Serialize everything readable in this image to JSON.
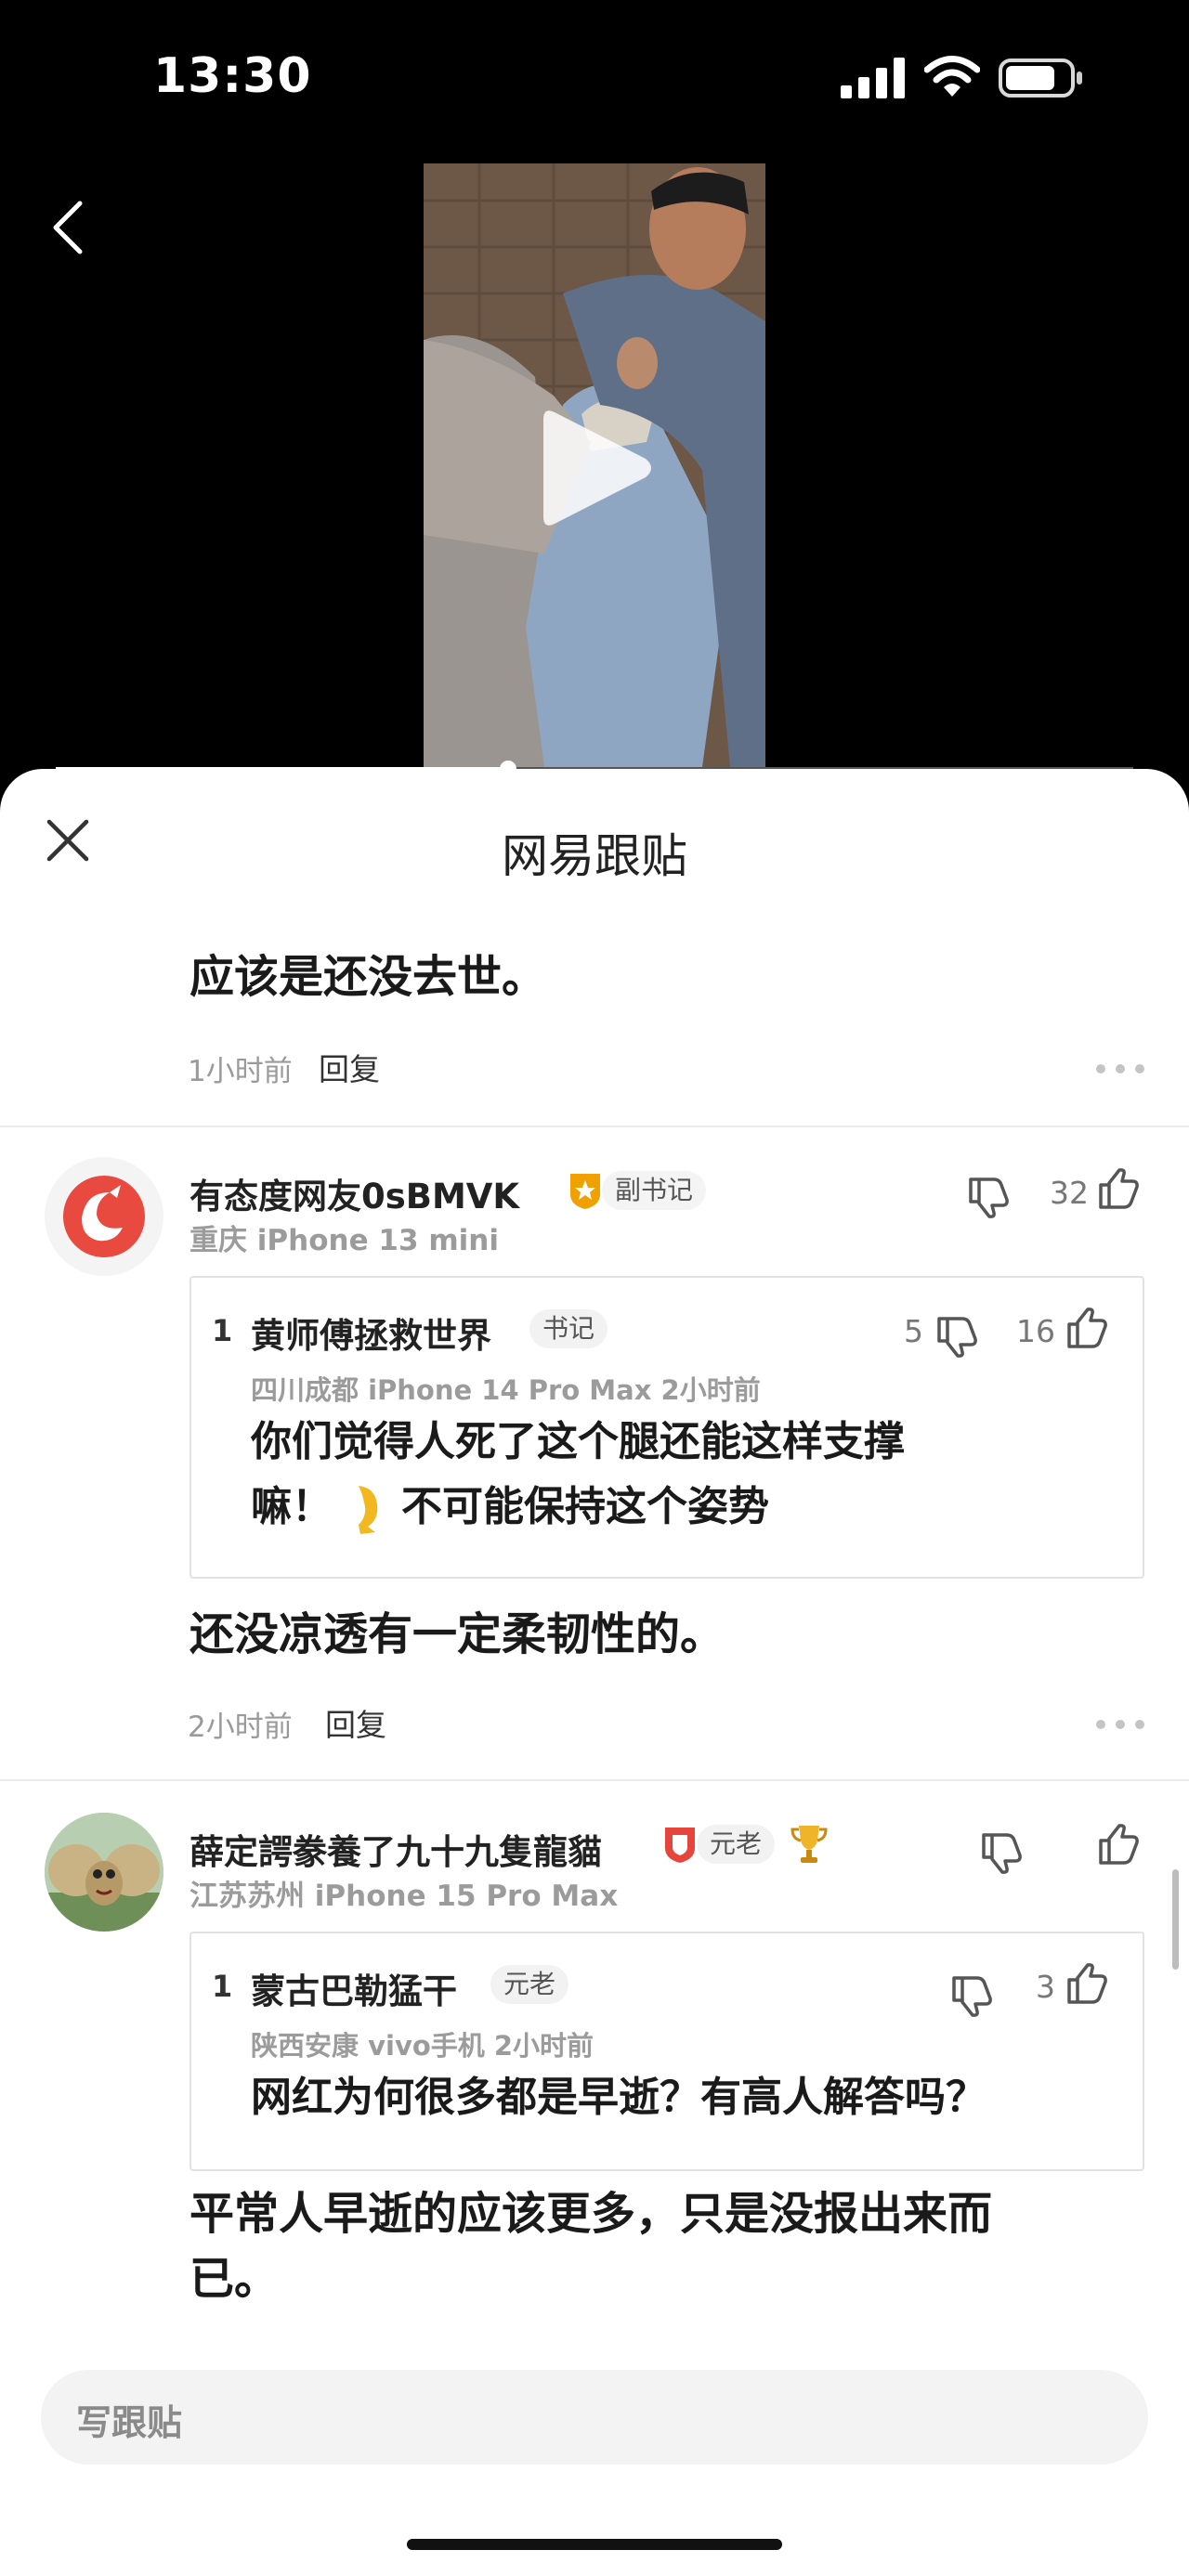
{
  "status_bar": {
    "time": "13:30"
  },
  "video": {
    "progress": 0.42
  },
  "sheet": {
    "title": "网易跟贴",
    "compose_placeholder": "写跟贴"
  },
  "comments": [
    {
      "text": "应该是还没去世。",
      "time": "1小时前",
      "reply_label": "回复"
    },
    {
      "user": "有态度网友0sBMVK",
      "badge": "副书记",
      "location_device": "重庆  iPhone 13 mini",
      "likes": "32",
      "quote": {
        "index": "1",
        "user": "黄师傅拯救世界",
        "badge": "书记",
        "dislikes": "5",
        "likes": "16",
        "meta": "四川成都  iPhone 14 Pro Max  2小时前",
        "text_line1": "你们觉得人死了这个腿还能这样支撑",
        "text_line2_a": "嘛！",
        "text_line2_b": "不可能保持这个姿势"
      },
      "text": "还没凉透有一定柔韧性的。",
      "time": "2小时前",
      "reply_label": "回复"
    },
    {
      "user": "薛定諤豢養了九十九隻龍貓",
      "badge": "元老",
      "location_device": "江苏苏州  iPhone 15 Pro Max",
      "quote": {
        "index": "1",
        "user": "蒙古巴勒猛干",
        "badge": "元老",
        "likes": "3",
        "meta": "陕西安康  vivo手机  2小时前",
        "text": "网红为何很多都是早逝？有高人解答吗？"
      },
      "text_line1": "平常人早逝的应该更多，只是没报出来而",
      "text_line2": "已。"
    }
  ],
  "colors": {
    "accent_orange": "#f0a000",
    "badge_red": "#e5453a",
    "avatar_red": "#e84a3f"
  }
}
